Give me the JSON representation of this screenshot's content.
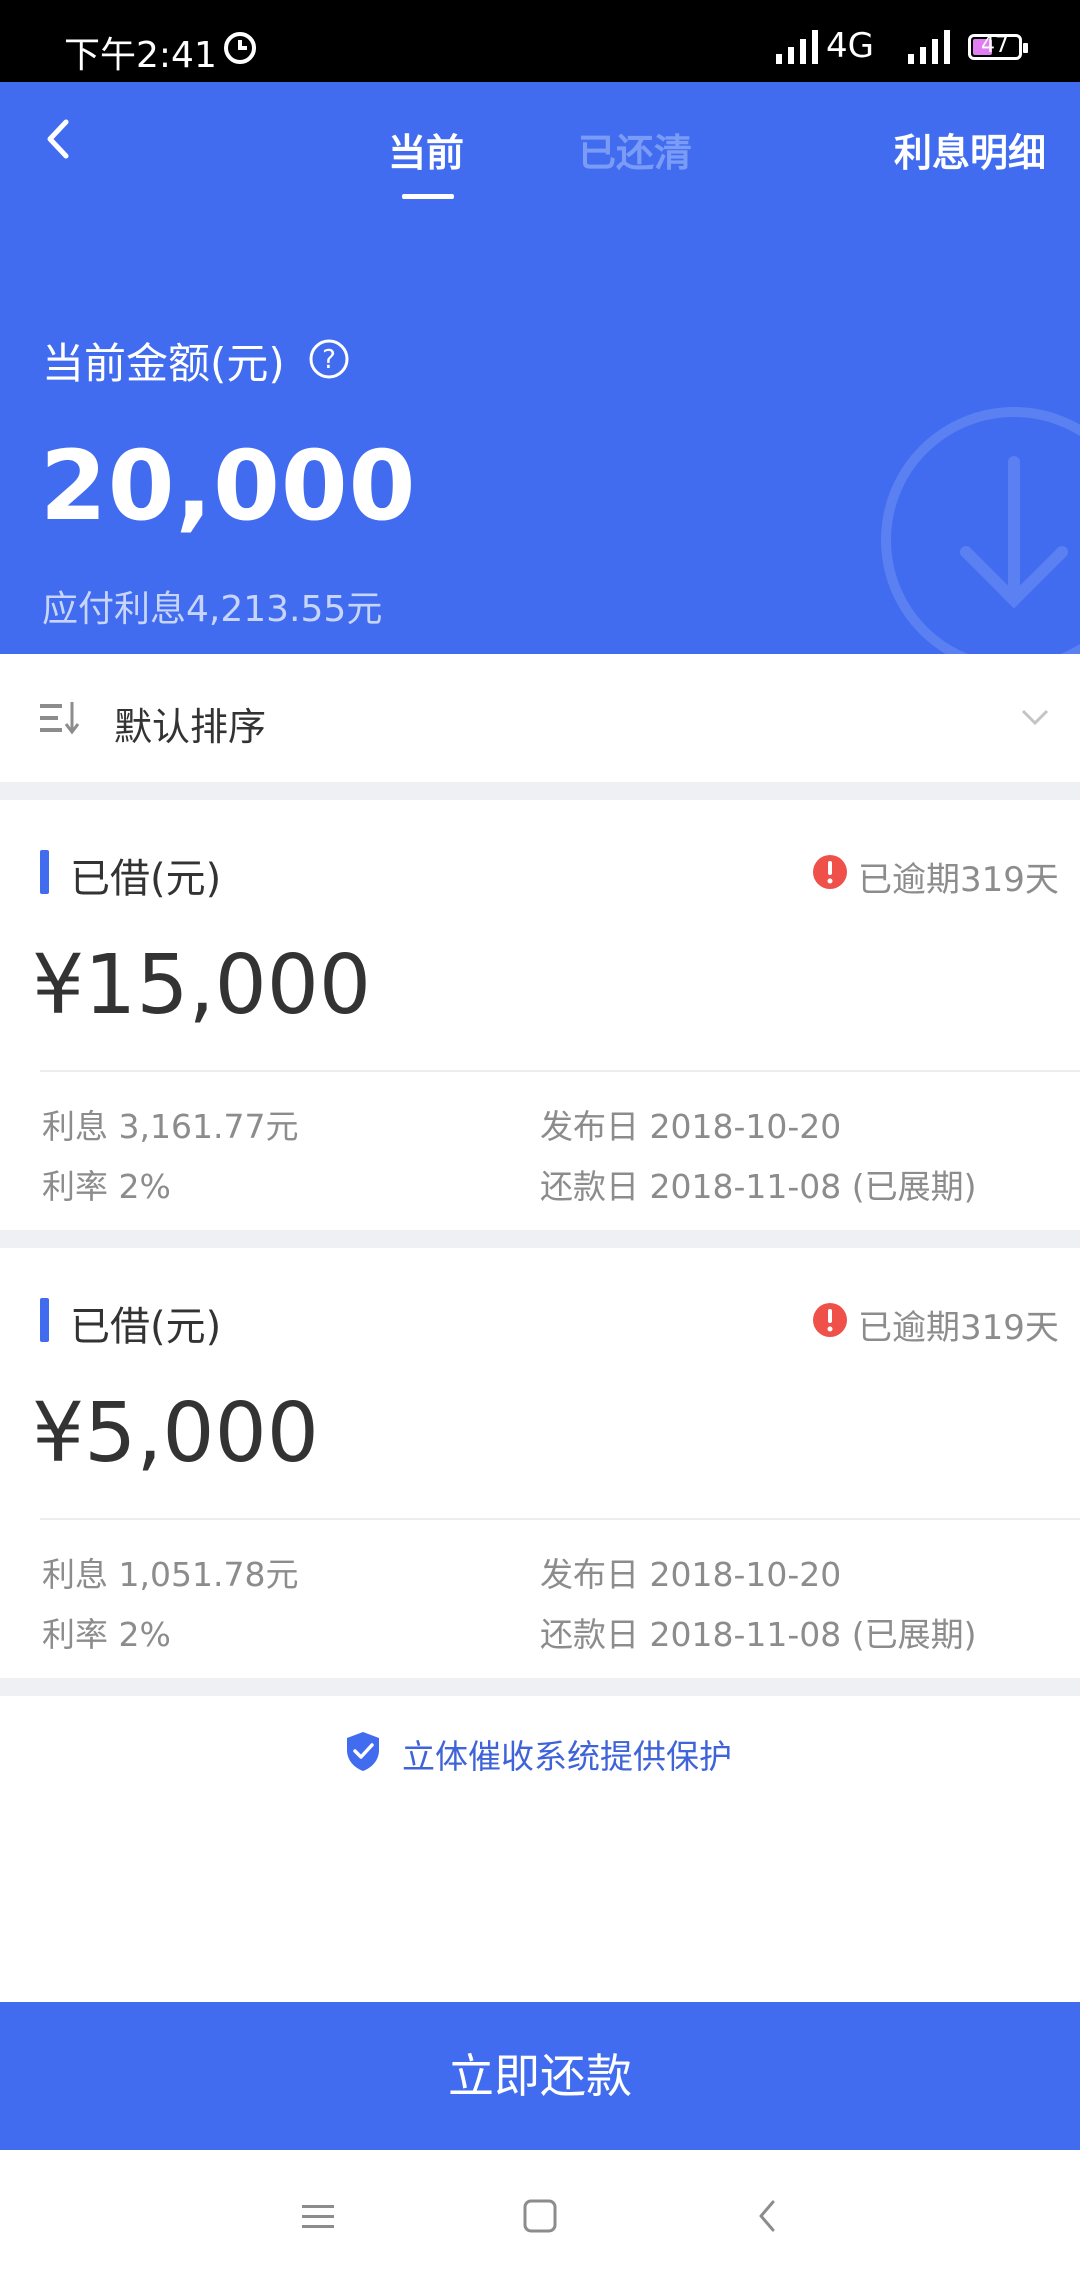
{
  "status_bar": {
    "time": "下午2:41",
    "network": "4G",
    "battery": "47"
  },
  "header": {
    "tabs": [
      {
        "label": "当前",
        "active": true
      },
      {
        "label": "已还清",
        "active": false
      }
    ],
    "detail_link": "利息明细",
    "amount_label": "当前金额(元)",
    "amount": "20,000",
    "interest_due": "应付利息4,213.55元"
  },
  "sort": {
    "label": "默认排序"
  },
  "loans": [
    {
      "title": "已借(元)",
      "overdue": "已逾期319天",
      "amount": "¥15,000",
      "interest": "利息 3,161.77元",
      "rate": "利率 2%",
      "publish_date": "发布日 2018-10-20",
      "repay_date": "还款日 2018-11-08 (已展期)"
    },
    {
      "title": "已借(元)",
      "overdue": "已逾期319天",
      "amount": "¥5,000",
      "interest": "利息 1,051.78元",
      "rate": "利率 2%",
      "publish_date": "发布日 2018-10-20",
      "repay_date": "还款日 2018-11-08 (已展期)"
    }
  ],
  "protection_text": "立体催收系统提供保护",
  "repay_button": "立即还款",
  "colors": {
    "primary": "#416cf0",
    "alert": "#f0504a",
    "divider": "#eff0f4"
  },
  "icons": [
    "back-icon",
    "help-icon",
    "sort-icon",
    "chevron-down-icon",
    "alert-icon",
    "shield-check-icon",
    "menu-icon",
    "home-icon",
    "back-nav-icon"
  ]
}
